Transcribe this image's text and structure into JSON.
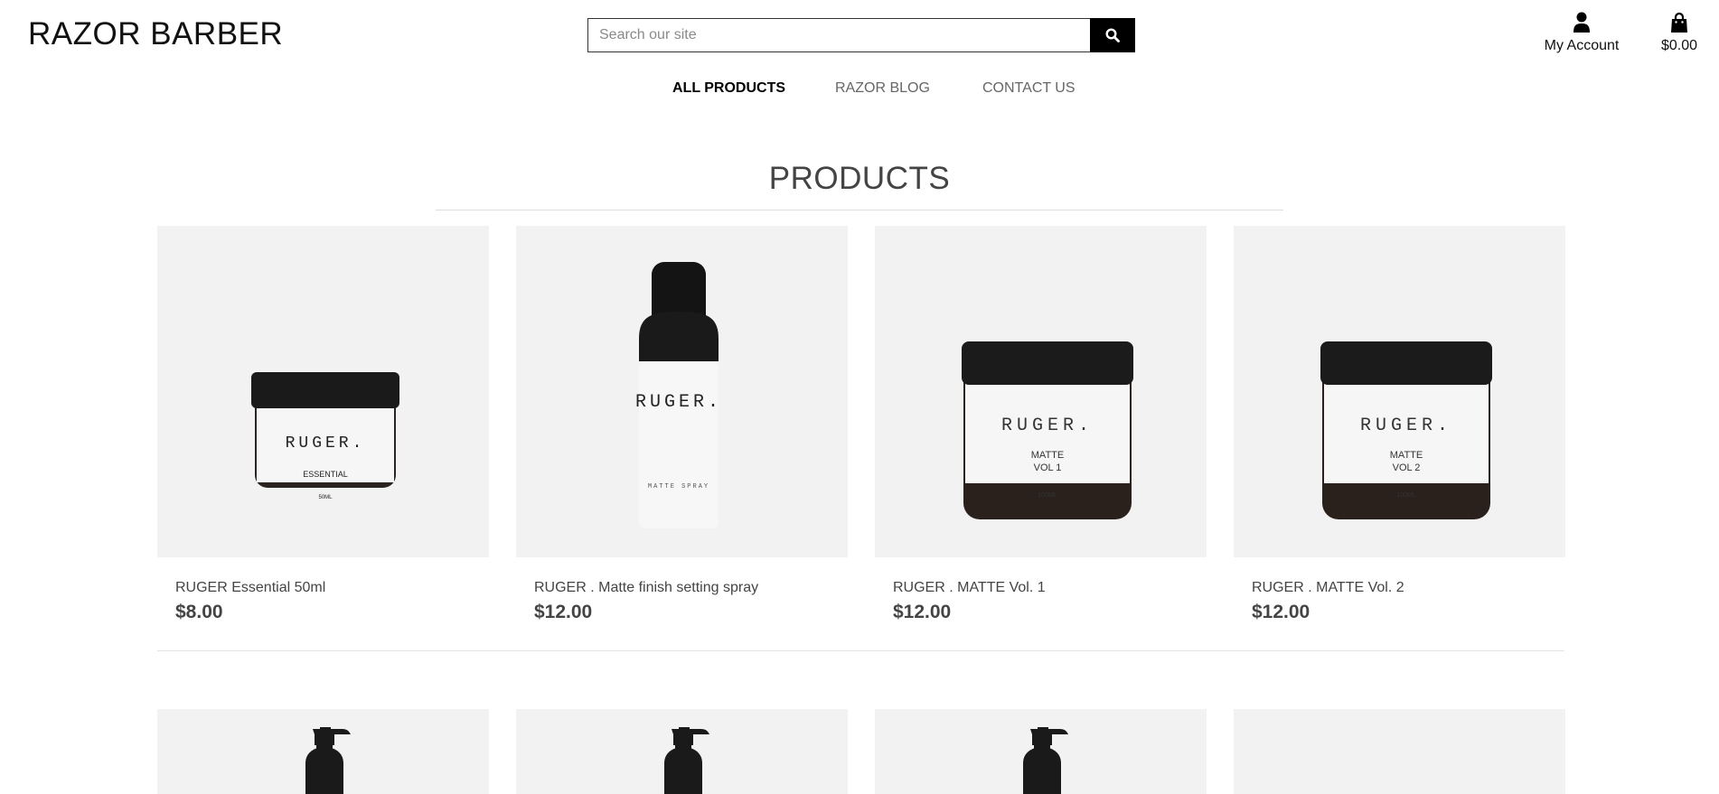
{
  "header": {
    "brand": "RAZOR BARBER",
    "search_placeholder": "Search our site",
    "account_label": "My Account",
    "cart_total": "$0.00"
  },
  "nav": [
    {
      "label": "ALL PRODUCTS",
      "active": true
    },
    {
      "label": "RAZOR BLOG",
      "active": false
    },
    {
      "label": "CONTACT US",
      "active": false
    }
  ],
  "page_title": "PRODUCTS",
  "products": [
    {
      "name": "RUGER Essential 50ml",
      "price": "$8.00",
      "image": "jar-small-icon",
      "label_brand": "RUGER.",
      "label_line1": "ESSENTIAL",
      "label_line2": "",
      "label_size": "50ML"
    },
    {
      "name": "RUGER . Matte finish setting spray",
      "price": "$12.00",
      "image": "spray-bottle-icon",
      "label_brand": "RUGER.",
      "label_line1": "MATTE SPRAY",
      "label_line2": "",
      "label_size": ""
    },
    {
      "name": "RUGER . MATTE Vol. 1",
      "price": "$12.00",
      "image": "jar-large-icon",
      "label_brand": "RUGER.",
      "label_line1": "MATTE",
      "label_line2": "VOL 1",
      "label_size": "100ML"
    },
    {
      "name": "RUGER . MATTE Vol. 2",
      "price": "$12.00",
      "image": "jar-large-icon",
      "label_brand": "RUGER.",
      "label_line1": "MATTE",
      "label_line2": "VOL 2",
      "label_size": "100ML"
    }
  ],
  "colors": {
    "accent": "#000000",
    "tile_bg": "#f2f2f2",
    "text_muted": "#666666"
  }
}
